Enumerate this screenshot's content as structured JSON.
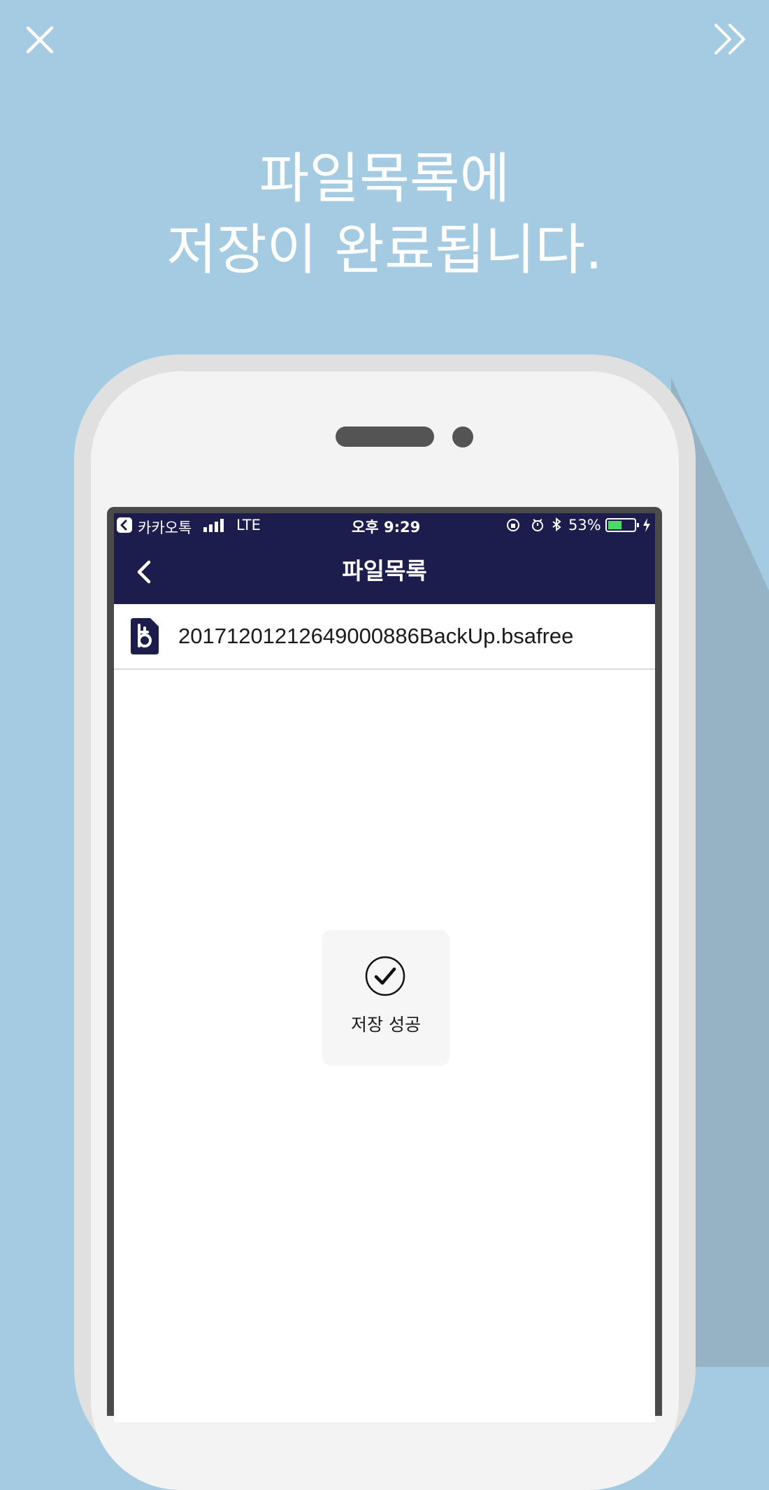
{
  "background_color": "#a4cbe1",
  "header_color": "#1c1c4d",
  "top_bar": {
    "close_icon": "close-icon",
    "next_icon": "double-chevron-right-icon"
  },
  "headline": {
    "line1": "파일목록에",
    "line2": "저장이 완료됩니다."
  },
  "status_bar": {
    "back_app": "카카오톡",
    "network": "LTE",
    "time": "오후 9:29",
    "battery_percent": "53%",
    "battery_level": 0.53
  },
  "nav": {
    "back_icon": "chevron-left-icon",
    "title": "파일목록"
  },
  "files": [
    {
      "name": "20171201212649000886BackUp.bsafree",
      "icon": "bsafree-file-icon"
    }
  ],
  "toast": {
    "icon": "check-circle-icon",
    "label": "저장 성공"
  }
}
